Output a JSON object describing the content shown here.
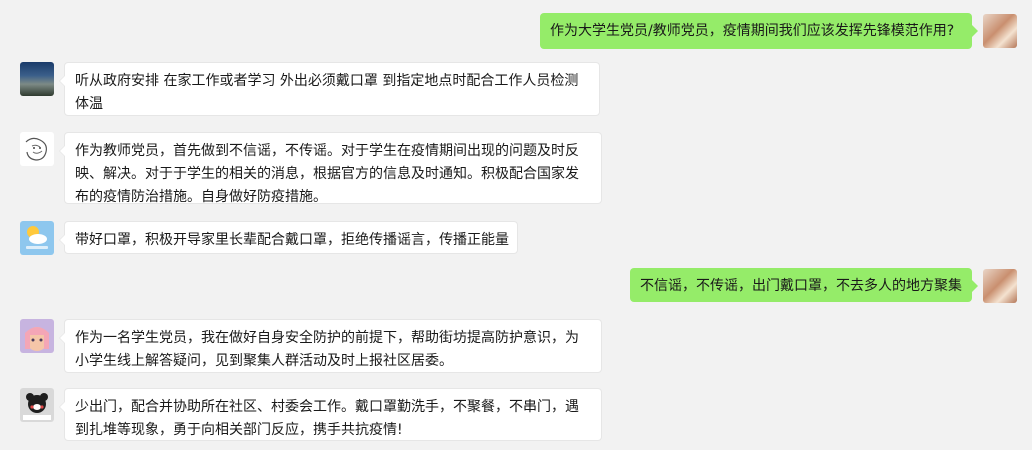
{
  "chat": {
    "messages": [
      {
        "side": "right",
        "sender": "me",
        "avatar_icon": "food-photo-avatar",
        "text": "作为大学生党员/教师党员，疫情期间我们应该发挥先锋模范作用?"
      },
      {
        "side": "left",
        "avatar_icon": "city-street-avatar",
        "text": "听从政府安排 在家工作或者学习 外出必须戴口罩 到指定地点时配合工作人员检测体温"
      },
      {
        "side": "left",
        "avatar_icon": "line-sketch-avatar",
        "text": "作为教师党员，首先做到不信谣，不传谣。对于学生在疫情期间出现的问题及时反映、解决。对于于学生的相关的消息，根据官方的信息及时通知。积极配合国家发布的疫情防治措施。自身做好防疫措施。"
      },
      {
        "side": "left",
        "avatar_icon": "weather-sun-cloud-avatar",
        "text": "带好口罩，积极开导家里长辈配合戴口罩，拒绝传播谣言，传播正能量"
      },
      {
        "side": "right",
        "sender": "me",
        "avatar_icon": "food-photo-avatar",
        "text": "不信谣，不传谣，出门戴口罩，不去多人的地方聚集"
      },
      {
        "side": "left",
        "avatar_icon": "anime-girl-avatar",
        "text": "作为一名学生党员，我在做好自身安全防护的前提下，帮助街坊提高防护意识，为小学生线上解答疑问，见到聚集人群活动及时上报社区居委。"
      },
      {
        "side": "left",
        "avatar_icon": "bear-mascot-avatar",
        "text": "少出门，配合并协助所在社区、村委会工作。戴口罩勤洗手，不聚餐，不串门，遇到扎堆等现象，勇于向相关部门反应，携手共抗疫情!"
      }
    ]
  },
  "colors": {
    "background": "#f2f2f2",
    "bubble_self": "#95ec69",
    "bubble_other": "#ffffff"
  }
}
